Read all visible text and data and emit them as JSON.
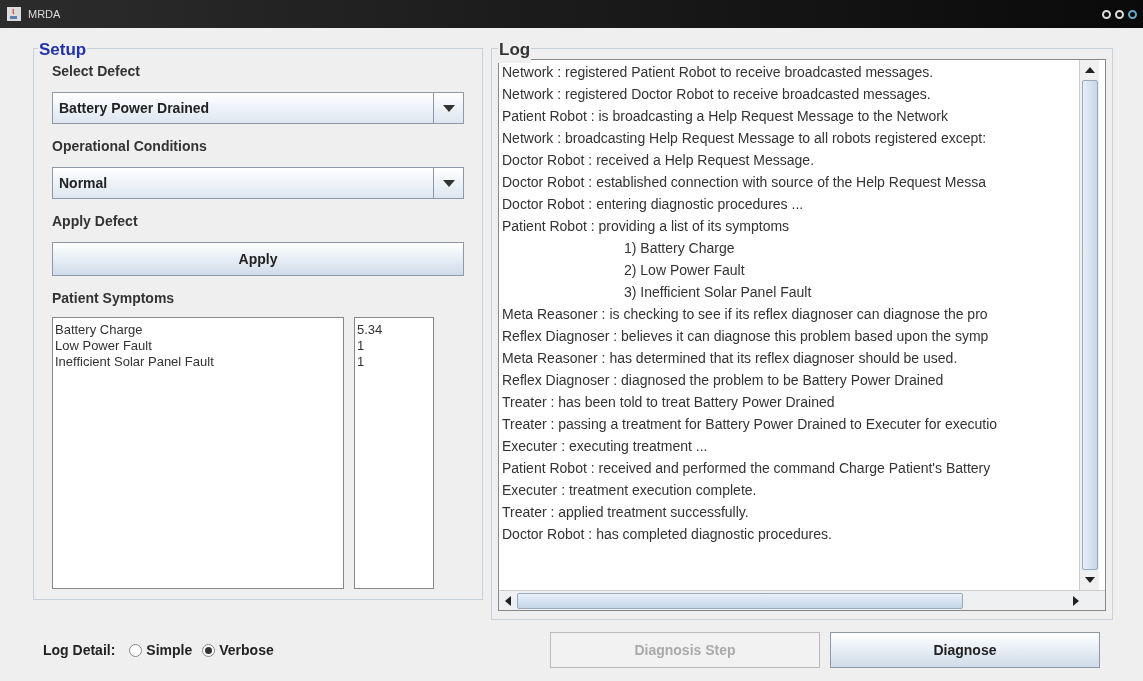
{
  "window": {
    "title": "MRDA"
  },
  "setup": {
    "title": "Setup",
    "select_defect": {
      "label": "Select Defect",
      "value": "Battery Power Drained"
    },
    "operational_conditions": {
      "label": "Operational Conditions",
      "value": "Normal"
    },
    "apply_defect": {
      "label": "Apply Defect",
      "button": "Apply"
    },
    "patient_symptoms": {
      "label": "Patient Symptoms",
      "rows": [
        {
          "name": "Battery Charge",
          "value": "5.34"
        },
        {
          "name": "Low Power Fault",
          "value": "1"
        },
        {
          "name": "Inefficient Solar Panel Fault",
          "value": "1"
        }
      ]
    }
  },
  "log": {
    "title": "Log",
    "lines": [
      {
        "kind": "line",
        "text": "Network : registered Patient Robot to receive broadcasted messages."
      },
      {
        "kind": "line",
        "text": "Network : registered Doctor Robot to receive broadcasted messages."
      },
      {
        "kind": "line",
        "text": "Patient Robot : is broadcasting a Help Request Message to the Network"
      },
      {
        "kind": "line",
        "text": "Network : broadcasting Help Request Message to all robots registered except:"
      },
      {
        "kind": "line",
        "text": "Doctor Robot : received a Help Request Message."
      },
      {
        "kind": "line",
        "text": "Doctor Robot : established connection with source of the Help Request Messa"
      },
      {
        "kind": "line",
        "text": "Doctor Robot : entering diagnostic procedures ..."
      },
      {
        "kind": "line",
        "text": "Patient Robot : providing a list of its symptoms"
      },
      {
        "kind": "sub",
        "text": "1) Battery Charge"
      },
      {
        "kind": "sub",
        "text": "2) Low Power Fault"
      },
      {
        "kind": "sub",
        "text": "3) Inefficient Solar Panel Fault"
      },
      {
        "kind": "line",
        "text": "Meta Reasoner : is checking to see if its reflex diagnoser can diagnose the pro"
      },
      {
        "kind": "line",
        "text": "Reflex Diagnoser : believes it can diagnose this problem based upon the symp"
      },
      {
        "kind": "line",
        "text": "Meta Reasoner : has determined that its reflex diagnoser should be used."
      },
      {
        "kind": "line",
        "text": "Reflex Diagnoser : diagnosed the problem to be Battery Power Drained"
      },
      {
        "kind": "line",
        "text": "Treater : has been told to treat Battery Power Drained"
      },
      {
        "kind": "line",
        "text": "Treater : passing a treatment for Battery Power Drained to Executer for executio"
      },
      {
        "kind": "line",
        "text": "Executer : executing treatment ..."
      },
      {
        "kind": "line",
        "text": "Patient Robot : received and performed the command Charge Patient's Battery"
      },
      {
        "kind": "line",
        "text": "Executer : treatment execution complete."
      },
      {
        "kind": "line",
        "text": "Treater : applied treatment successfully."
      },
      {
        "kind": "line",
        "text": "Doctor Robot : has completed diagnostic procedures."
      }
    ]
  },
  "log_detail": {
    "label": "Log Detail:",
    "options": [
      {
        "label": "Simple",
        "selected": false
      },
      {
        "label": "Verbose",
        "selected": true
      }
    ]
  },
  "buttons": [
    {
      "label": "Diagnosis Step",
      "disabled": true
    },
    {
      "label": "Diagnose",
      "disabled": false
    }
  ]
}
